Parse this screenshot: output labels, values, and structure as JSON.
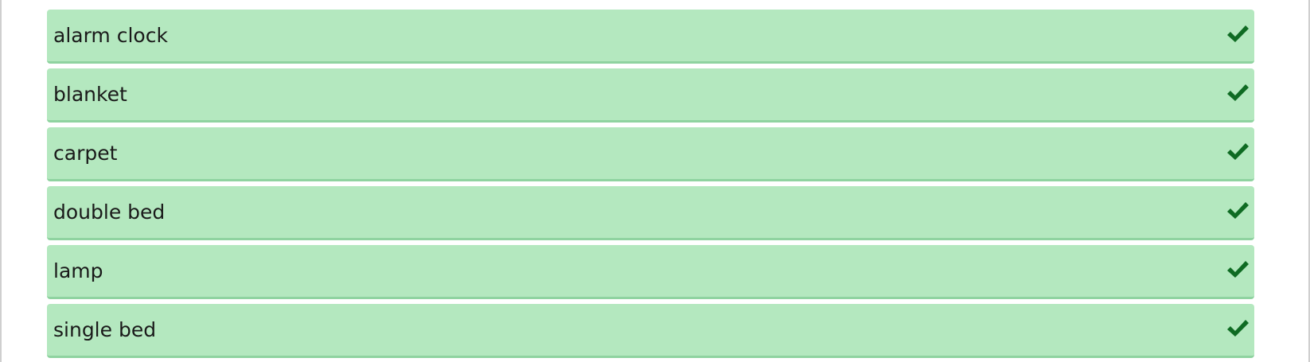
{
  "colors": {
    "item_background": "#b4e8bf",
    "item_border": "#8fd3a0",
    "check": "#0f6b23",
    "text": "#1a1a1a"
  },
  "items": [
    {
      "label": "alarm clock",
      "status_icon": "check-icon"
    },
    {
      "label": "blanket",
      "status_icon": "check-icon"
    },
    {
      "label": "carpet",
      "status_icon": "check-icon"
    },
    {
      "label": "double bed",
      "status_icon": "check-icon"
    },
    {
      "label": "lamp",
      "status_icon": "check-icon"
    },
    {
      "label": "single bed",
      "status_icon": "check-icon"
    }
  ]
}
